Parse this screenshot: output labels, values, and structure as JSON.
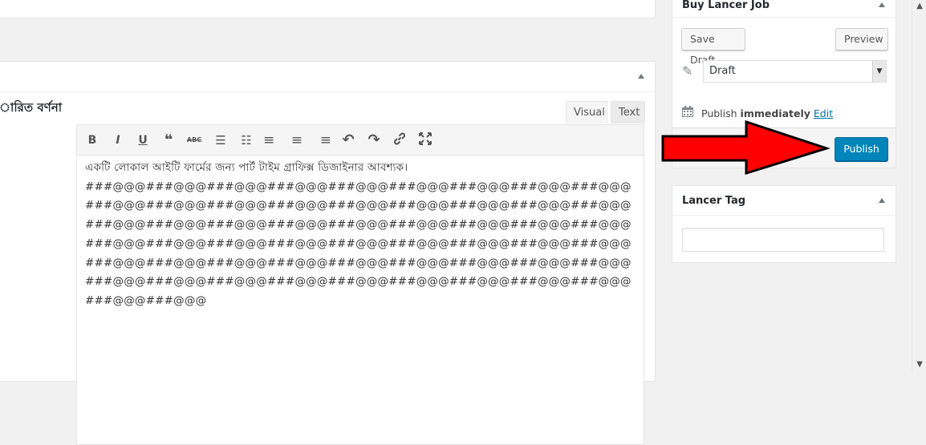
{
  "description": {
    "title": "ারিত বর্ণনা",
    "tabs": {
      "visual": "Visual",
      "text": "Text"
    },
    "toolbar": [
      {
        "name": "bold",
        "glyph": "B"
      },
      {
        "name": "italic",
        "glyph": "I"
      },
      {
        "name": "underline",
        "glyph": "U"
      },
      {
        "name": "blockquote",
        "glyph": "❝"
      },
      {
        "name": "strikethrough",
        "glyph": "ABC"
      },
      {
        "name": "bullet-list",
        "glyph": "☰"
      },
      {
        "name": "numbered-list",
        "glyph": "☷"
      },
      {
        "name": "align-left",
        "glyph": "≡"
      },
      {
        "name": "align-center",
        "glyph": "≡"
      },
      {
        "name": "align-right",
        "glyph": "≡"
      },
      {
        "name": "undo",
        "glyph": "↶"
      },
      {
        "name": "redo",
        "glyph": "↷"
      },
      {
        "name": "link",
        "glyph": "🔗"
      },
      {
        "name": "fullscreen",
        "glyph": "⤢"
      }
    ],
    "content_lines": [
      "একটি লোকাল আইটি ফার্মের জন্য পার্ট টাইম গ্রাফিক্স ডিজাইনার আবশ্যক।",
      "###@@@###@@@###@@@###@@@###@@@###@@@###@@@###@@@###@@@",
      "###@@@###@@@###@@@###@@@###@@@###@@@###@@@###@@@###@@@",
      "###@@@###@@@###@@@###@@@###@@@###@@@###@@@###@@@###@@@",
      "###@@@###@@@###@@@###@@@###@@@###@@@###@@@###@@@###@@@",
      "###@@@###@@@###@@@###@@@###@@@###@@@###@@@###@@@###@@@",
      "###@@@###@@@###@@@###@@@###@@@###@@@###@@@###@@@###@@@",
      "###@@@###@@@"
    ]
  },
  "publish": {
    "title": "Buy Lancer Job",
    "save_draft": "Save Draft",
    "preview": "Preview",
    "status_value": "Draft",
    "time_label": "Publish",
    "time_value": "immediately",
    "edit_link": "Edit",
    "publish_button": "Publish"
  },
  "tags": {
    "title": "Lancer Tag",
    "input_value": ""
  },
  "colors": {
    "primary_button": "#0085ba",
    "annotation_arrow": "#ff0000",
    "link": "#0073aa"
  }
}
